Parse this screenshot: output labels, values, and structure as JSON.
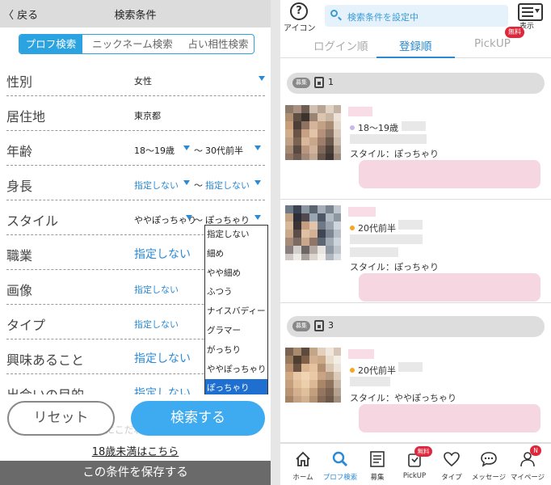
{
  "left": {
    "back_label": "〈 戻る",
    "title": "検索条件",
    "segments": [
      "プロフ検索",
      "ニックネーム検索",
      "占い相性検索"
    ],
    "rows": {
      "gender": {
        "label": "性別",
        "value": "女性"
      },
      "residence": {
        "label": "居住地",
        "value": "東京都"
      },
      "age": {
        "label": "年齢",
        "from": "18〜19歳",
        "to": "30代前半"
      },
      "height": {
        "label": "身長",
        "from": "指定しない",
        "to": "指定しない"
      },
      "style": {
        "label": "スタイル",
        "from": "ややぽっちゃり",
        "to": "ぽっちゃり"
      },
      "job": {
        "label": "職業",
        "value": "指定しない"
      },
      "image": {
        "label": "画像",
        "value": "指定しない"
      },
      "type": {
        "label": "タイプ",
        "value": "指定しない"
      },
      "interest": {
        "label": "興味あること",
        "value": "指定しない"
      },
      "purpose": {
        "label": "出会いの目的",
        "value": "指定しない"
      }
    },
    "tilde": "〜",
    "dropdown_options": [
      "指定しない",
      "細め",
      "やや細め",
      "ふつう",
      "ナイスバディー",
      "グラマー",
      "がっちり",
      "ややぽっちゃり",
      "ぽっちゃり"
    ],
    "dropdown_selected": "ぽっちゃり",
    "ghost_text": "さらにこだわる",
    "reset_label": "リセット",
    "search_label": "検索する",
    "under18_link": "18歳未満はこちら",
    "save_label": "この条件を保存する"
  },
  "right": {
    "icon_label": "アイコン",
    "search_status": "検索条件を設定中",
    "display_label": "表示",
    "tabs": [
      "ログイン順",
      "登録順",
      "PickUP"
    ],
    "active_tab": "登録順",
    "free_badge": "無料",
    "groups": [
      {
        "pill": "募集",
        "number": "1"
      },
      {
        "pill": "募集",
        "number": "3"
      }
    ],
    "cards": [
      {
        "age": "18〜19歳",
        "style": "スタイル：ぽっちゃり",
        "dot_color": "#c8b8e8"
      },
      {
        "age": "20代前半",
        "style": "スタイル：ぽっちゃり",
        "dot_color": "#f5a623"
      },
      {
        "age": "20代前半",
        "style": "スタイル：ややぽっちゃり",
        "dot_color": "#f5a623"
      }
    ],
    "nav": [
      {
        "label": "ホーム",
        "icon": "home-icon"
      },
      {
        "label": "プロフ検索",
        "icon": "search-icon"
      },
      {
        "label": "募集",
        "icon": "board-icon"
      },
      {
        "label": "PickUP",
        "icon": "pickup-icon",
        "badge": "無料"
      },
      {
        "label": "タイプ",
        "icon": "heart-icon"
      },
      {
        "label": "メッセージ",
        "icon": "message-icon"
      },
      {
        "label": "マイページ",
        "icon": "user-icon",
        "badge": "N"
      }
    ],
    "accent_color": "#2a8ad6",
    "badge_color": "#e0263a"
  }
}
